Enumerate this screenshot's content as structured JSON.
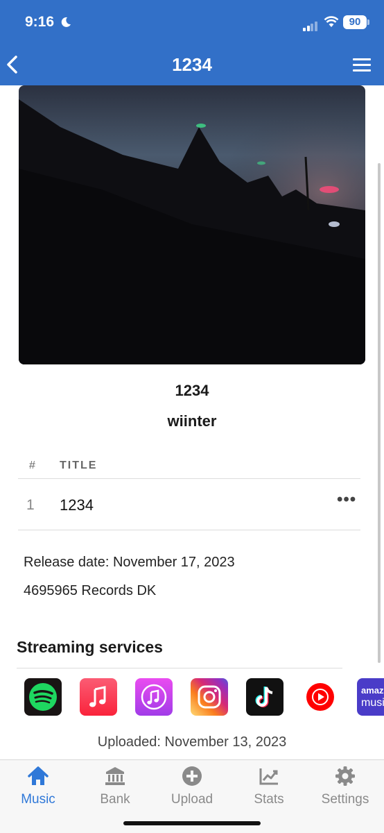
{
  "status_bar": {
    "time": "9:16",
    "battery": "90"
  },
  "header": {
    "title": "1234",
    "back_icon": "chevron-left-icon",
    "menu_icon": "hamburger-menu-icon"
  },
  "album": {
    "title": "1234",
    "artist": "wiinter"
  },
  "tracklist": {
    "col_number": "#",
    "col_title": "TITLE",
    "tracks": [
      {
        "number": "1",
        "title": "1234"
      }
    ]
  },
  "release": {
    "release_date": "Release date: November 17, 2023",
    "label": "4695965 Records DK"
  },
  "streaming": {
    "title": "Streaming services",
    "services": [
      "spotify-icon",
      "apple-music-icon",
      "itunes-icon",
      "instagram-icon",
      "tiktok-icon",
      "youtube-music-icon",
      "amazon-music-icon"
    ],
    "amazon_text_1": "amazo",
    "amazon_text_2": "musi"
  },
  "uploaded": "Uploaded: November 13, 2023",
  "tabbar": {
    "tabs": [
      {
        "label": "Music",
        "icon": "home-icon",
        "active": true
      },
      {
        "label": "Bank",
        "icon": "bank-icon",
        "active": false
      },
      {
        "label": "Upload",
        "icon": "plus-circle-icon",
        "active": false
      },
      {
        "label": "Stats",
        "icon": "chart-icon",
        "active": false
      },
      {
        "label": "Settings",
        "icon": "gear-icon",
        "active": false
      }
    ]
  },
  "colors": {
    "header": "#3270c8",
    "tab_active": "#2f78d8",
    "tab_inactive": "#8a8a8a"
  }
}
